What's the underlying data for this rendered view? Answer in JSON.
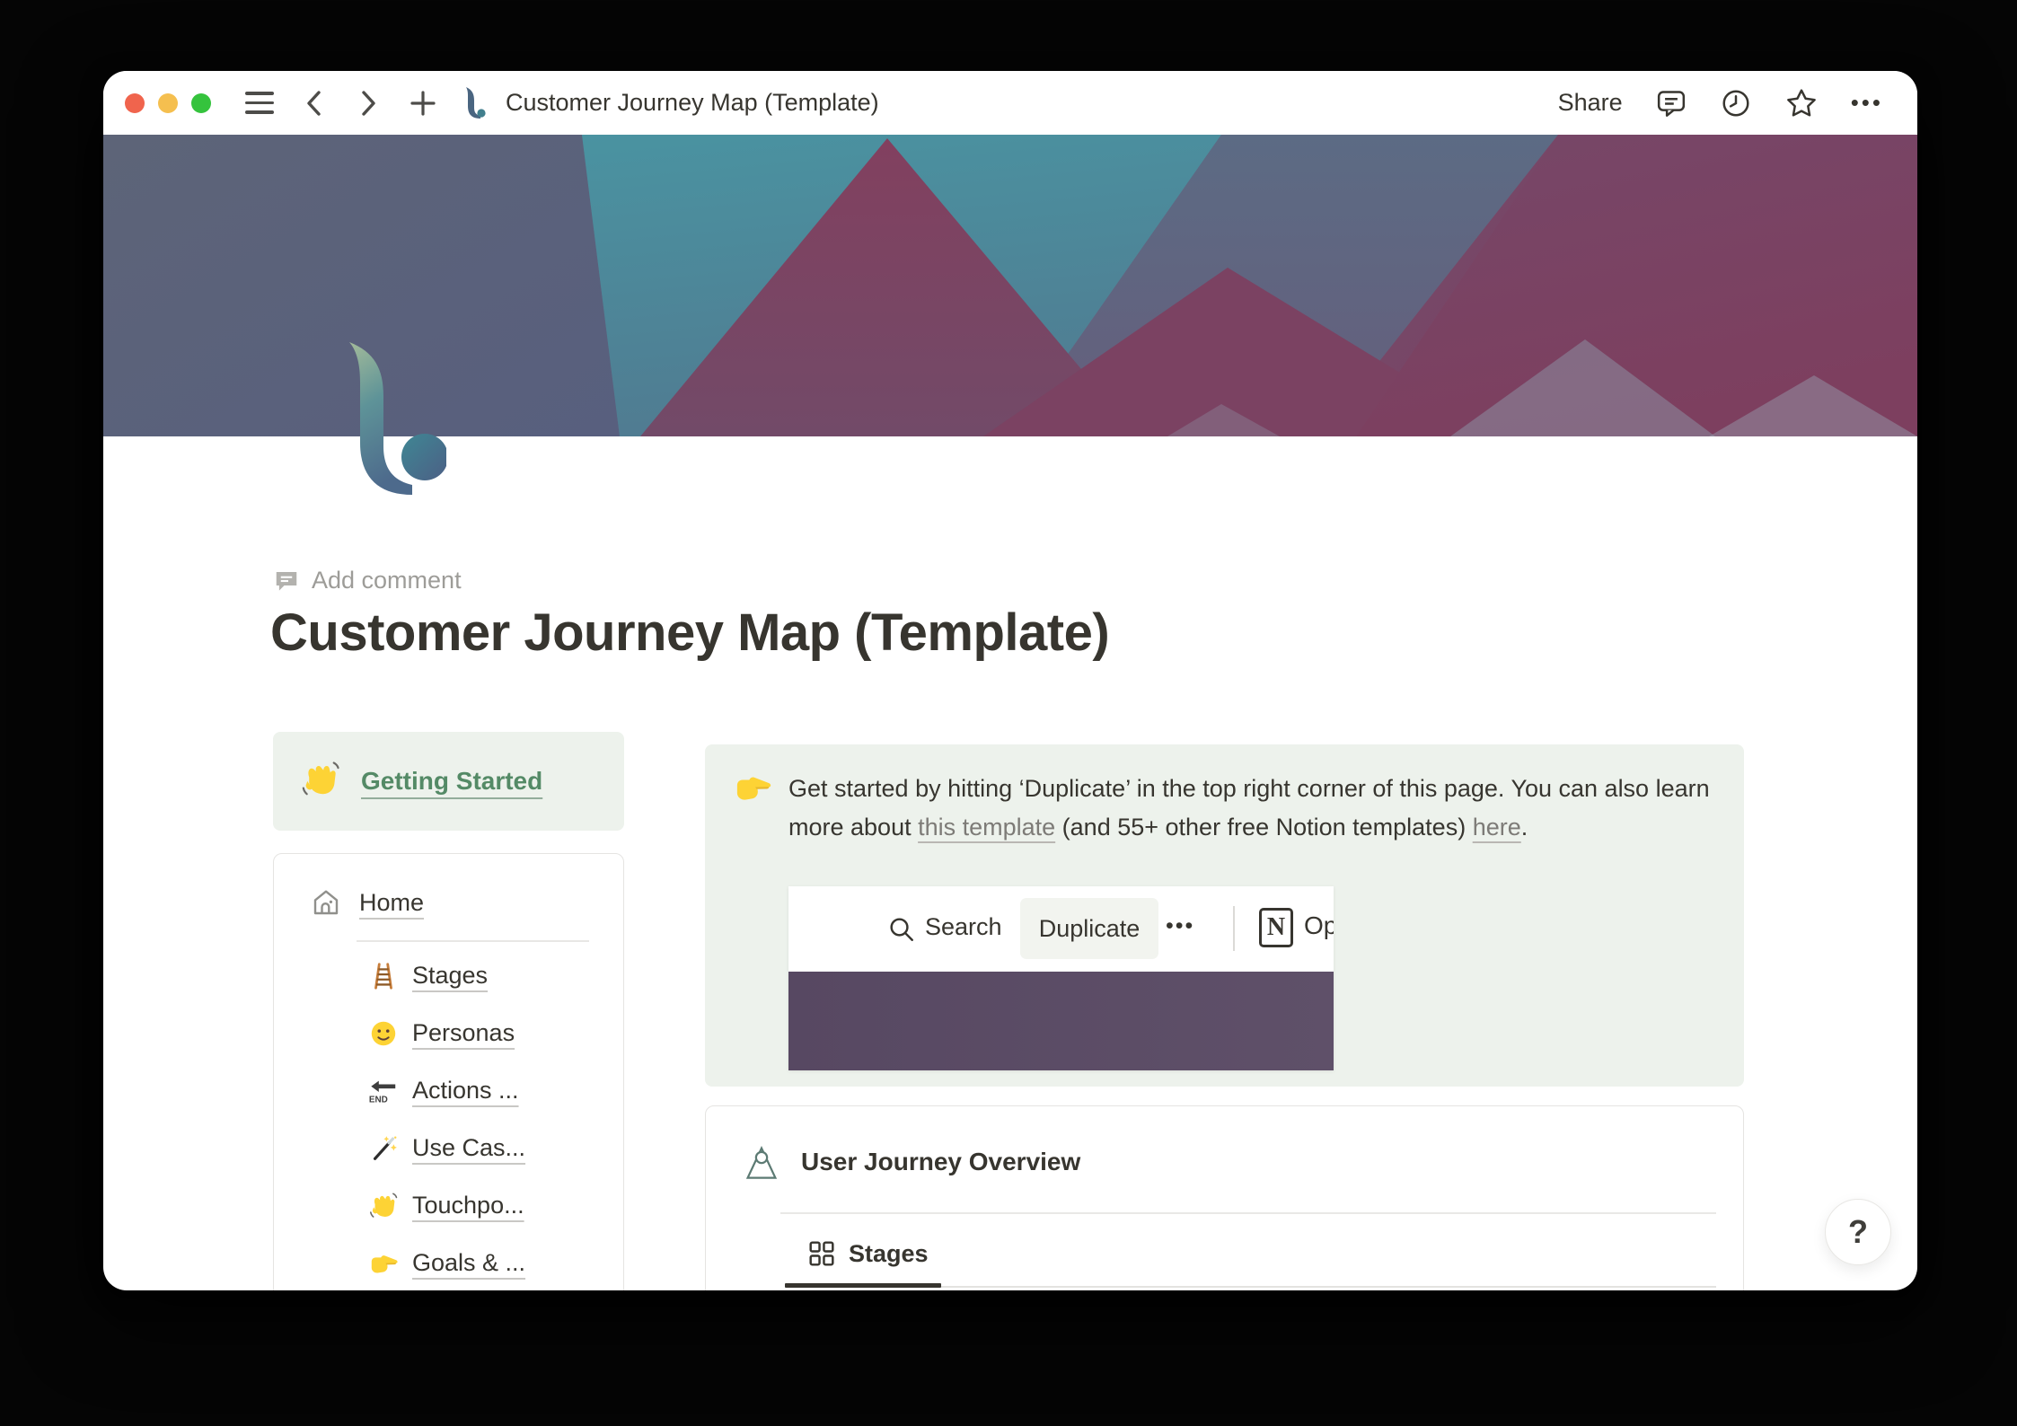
{
  "titlebar": {
    "title": "Customer Journey Map (Template)",
    "share_label": "Share",
    "more_label": "•••"
  },
  "page": {
    "add_comment_label": "Add comment",
    "title": "Customer Journey Map (Template)",
    "getting_started": {
      "icon": "wave-emoji",
      "label": "Getting Started"
    },
    "nav": {
      "home": {
        "icon": "house-icon",
        "label": "Home"
      },
      "items": [
        {
          "icon": "ladder-emoji",
          "label": "Stages"
        },
        {
          "icon": "smiley-emoji",
          "label": "Personas"
        },
        {
          "icon": "end-arrow-emoji",
          "label": "Actions ..."
        },
        {
          "icon": "magic-wand-emoji",
          "label": "Use Cas..."
        },
        {
          "icon": "wave-emoji",
          "label": "Touchpo..."
        },
        {
          "icon": "point-right-emoji",
          "label": "Goals & ..."
        }
      ]
    },
    "callout": {
      "icon": "point-right-emoji",
      "text_before_link1": "Get started by hitting ‘Duplicate’ in the top right corner of this page. You can also learn more about ",
      "link1": "this template",
      "text_between": " (and 55+ other free Notion templates) ",
      "link2": "here",
      "text_after": "."
    },
    "mini_screenshot": {
      "search_label": "Search",
      "duplicate_label": "Duplicate",
      "more_label": "•••",
      "notion_letter": "N",
      "open_label": "Op"
    },
    "overview": {
      "icon": "persona-icon",
      "title": "User Journey Overview",
      "tabs": [
        {
          "icon": "grid-icon",
          "label": "Stages",
          "active": true
        }
      ]
    },
    "help_label": "?",
    "end_arrow_text": "END"
  },
  "colors": {
    "accent_green": "#548a66",
    "callout_bg": "#edf2ec",
    "cover_teal": "#4b93a1",
    "cover_maroon": "#7b4262",
    "cover_slate": "#5b6377",
    "mini_purple": "#5a4b65",
    "link_gray": "#7d7b77"
  }
}
